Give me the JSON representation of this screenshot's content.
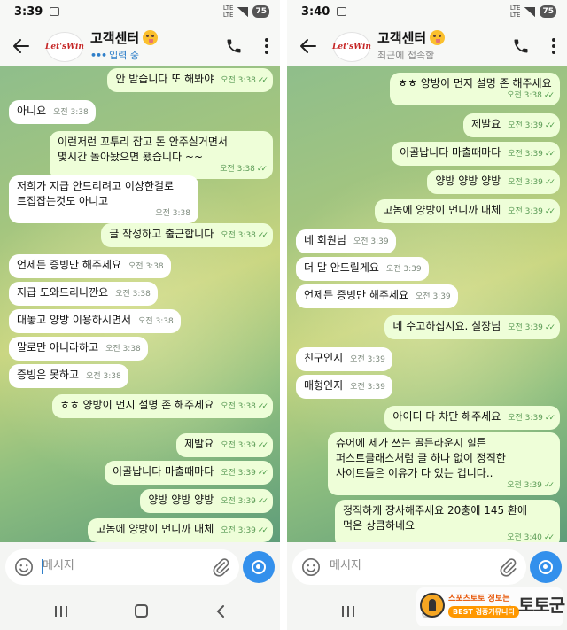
{
  "left": {
    "status": {
      "time": "3:39",
      "net_top": "LTE",
      "net_bottom": "LTE",
      "battery": "75"
    },
    "header": {
      "name": "고객센터",
      "status": "입력 중",
      "avatar_text": "Let'sWin"
    },
    "messages": [
      {
        "dir": "out",
        "text": "안 받습니다 또 해봐야",
        "time": "오전 3:38",
        "read": true
      },
      {
        "dir": "in",
        "text": "아니요",
        "time": "오전 3:38"
      },
      {
        "dir": "out",
        "text": "이런저런 꼬투리  잡고 돈 안주실거면서\n몇시간 놀아놨으면 됐습니다 ~~",
        "time": "오전 3:38",
        "read": true
      },
      {
        "dir": "in",
        "text": "저희가 지급 안드리려고 이상한걸로\n트집잡는것도 아니고",
        "time": "오전 3:38"
      },
      {
        "dir": "out",
        "text": "글 작성하고 출근합니다",
        "time": "오전 3:38",
        "read": true
      },
      {
        "dir": "in",
        "text": "언제든 증빙만 해주세요",
        "time": "오전 3:38"
      },
      {
        "dir": "in",
        "text": "지급 도와드리니깐요",
        "time": "오전 3:38"
      },
      {
        "dir": "in",
        "text": "대놓고 양방 이용하시면서",
        "time": "오전 3:38"
      },
      {
        "dir": "in",
        "text": "말로만 아니라하고",
        "time": "오전 3:38"
      },
      {
        "dir": "in",
        "text": "증빙은 못하고",
        "time": "오전 3:38"
      },
      {
        "dir": "out",
        "text": "ㅎㅎ 양방이 먼지 설명 존 해주세요",
        "time": "오전 3:38",
        "read": true
      },
      {
        "dir": "out",
        "text": "제발요",
        "time": "오전 3:39",
        "read": true
      },
      {
        "dir": "out",
        "text": "이골납니다 마출때마다",
        "time": "오전 3:39",
        "read": true
      },
      {
        "dir": "out",
        "text": "양방 양방 양방",
        "time": "오전 3:39",
        "read": true
      },
      {
        "dir": "out",
        "text": "고놈에 양방이 먼니까 대체",
        "time": "오전 3:39",
        "read": true
      }
    ],
    "input_placeholder": "메시지"
  },
  "right": {
    "status": {
      "time": "3:40",
      "net_top": "LTE",
      "net_bottom": "LTE",
      "battery": "75"
    },
    "header": {
      "name": "고객센터",
      "status": "최근에 접속함",
      "avatar_text": "Let'sWin"
    },
    "messages": [
      {
        "dir": "out",
        "text": "ㅎㅎ 양방이 먼지 설명 존 해주세요",
        "time": "오전 3:38",
        "read": true
      },
      {
        "dir": "out",
        "text": "제발요",
        "time": "오전 3:39",
        "read": true
      },
      {
        "dir": "out",
        "text": "이골납니다 마출때마다",
        "time": "오전 3:39",
        "read": true
      },
      {
        "dir": "out",
        "text": "양방 양방 양방",
        "time": "오전 3:39",
        "read": true
      },
      {
        "dir": "out",
        "text": "고놈에 양방이 먼니까 대체",
        "time": "오전 3:39",
        "read": true
      },
      {
        "dir": "in",
        "text": "네 회원님",
        "time": "오전 3:39"
      },
      {
        "dir": "in",
        "text": "더 말 안드릴게요",
        "time": "오전 3:39"
      },
      {
        "dir": "in",
        "text": "언제든 증빙만 해주세요",
        "time": "오전 3:39"
      },
      {
        "dir": "out",
        "text": "네 수고하십시요. 실장님",
        "time": "오전 3:39",
        "read": true
      },
      {
        "dir": "in",
        "text": "친구인지",
        "time": "오전 3:39"
      },
      {
        "dir": "in",
        "text": "매형인지",
        "time": "오전 3:39"
      },
      {
        "dir": "out",
        "text": "아이디 다 차단 해주세요",
        "time": "오전 3:39",
        "read": true
      },
      {
        "dir": "out",
        "text": "슈어에 제가 쓰는 골든라운지 힐튼\n퍼스트클래스처럼 글 하나 없이 정직한\n사이트들은 이유가 다 있는 겁니다..",
        "time": "오전 3:39",
        "read": true
      },
      {
        "dir": "out",
        "text": "정직하게 장사해주세요 20충에 145 환에\n먹은 상큼하네요",
        "time": "오전 3:40",
        "read": true
      }
    ],
    "input_placeholder": "메시지"
  },
  "watermark": {
    "line1": "스포츠토토 정보는",
    "line2": "BEST 검증커뮤니티",
    "big": "토토군"
  }
}
